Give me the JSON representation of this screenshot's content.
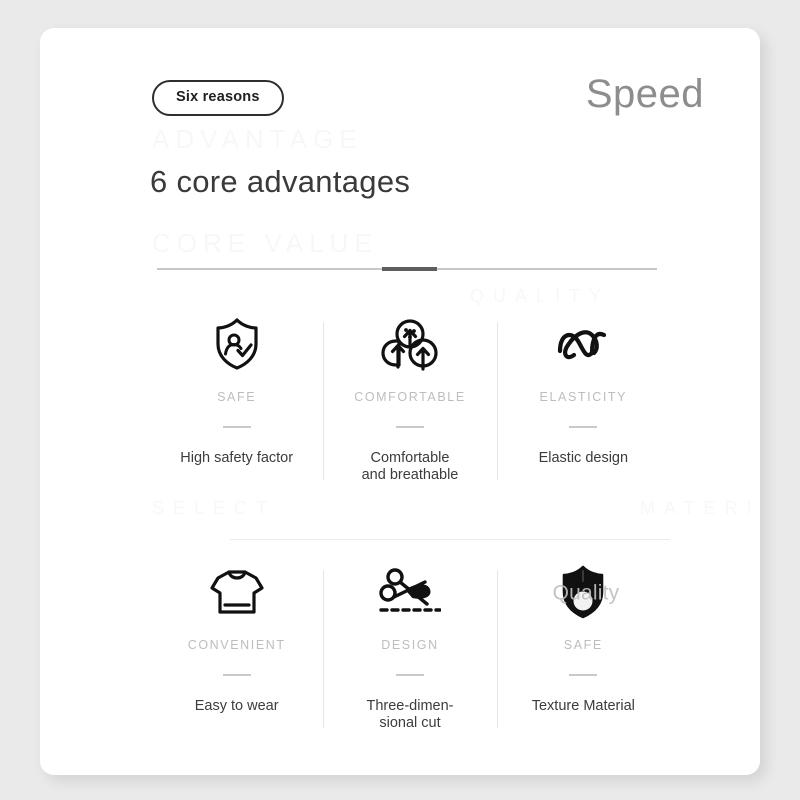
{
  "background_color": "#eaeaea",
  "card": {
    "background_color": "#ffffff"
  },
  "header": {
    "badge_label": "Six reasons",
    "brand_label": "Speed",
    "brand_color": "#8d8d8d"
  },
  "headline": "6 core advantages",
  "divider": {
    "track_color": "#c8c8c8",
    "active_color": "#5e5e5e",
    "active_start_pct": 45,
    "active_width_pct": 11
  },
  "watermarks": {
    "top": "ADVANTAGE",
    "under_headline": "CORE VALUE",
    "right": "QUALITY",
    "left_low": "SELECT",
    "right_low": "MATERIAL",
    "shield_label": "Quality"
  },
  "features": [
    {
      "icon": "shield-person-check-icon",
      "category": "SAFE",
      "description": "High safety factor"
    },
    {
      "icon": "breathable-clouds-arrows-icon",
      "category": "COMFORTABLE",
      "description": "Comfortable\nand breathable"
    },
    {
      "icon": "elastic-spring-coil-icon",
      "category": "ELASTICITY",
      "description": "Elastic design"
    },
    {
      "icon": "tshirt-icon",
      "category": "CONVENIENT",
      "description": "Easy to wear"
    },
    {
      "icon": "scissors-cut-icon",
      "category": "DESIGN",
      "description": "Three-dimen-\nsional cut"
    },
    {
      "icon": "shield-solid-quality-icon",
      "category": "SAFE",
      "description": "Texture Material"
    }
  ]
}
